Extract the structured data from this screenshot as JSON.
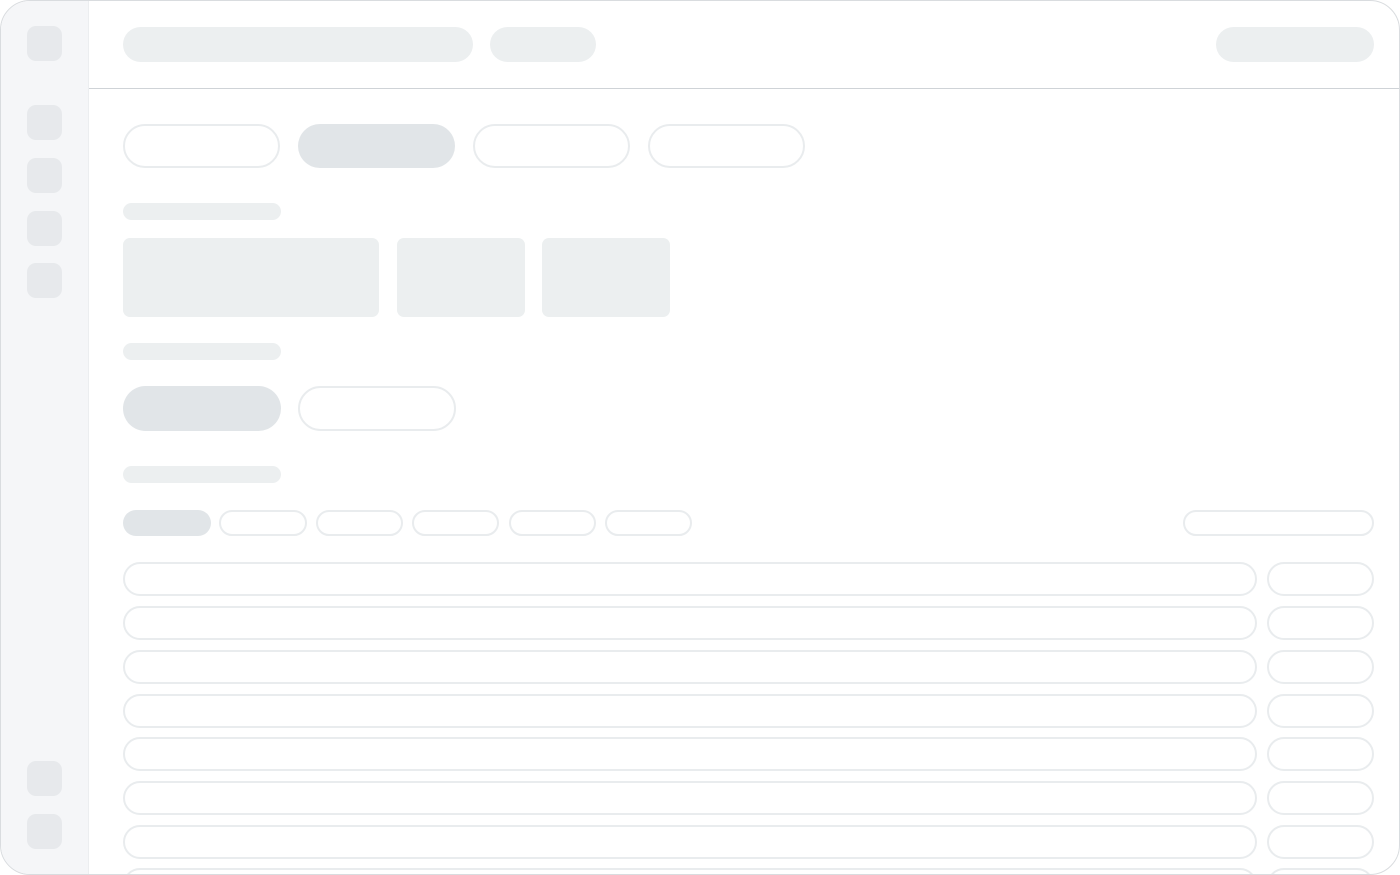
{
  "app": {
    "title": "",
    "breadcrumb": "",
    "header_action": ""
  },
  "sidebar": {
    "top_items": [
      "",
      "",
      "",
      "",
      ""
    ],
    "bottom_items": [
      "",
      ""
    ]
  },
  "tabs": [
    "",
    "",
    "",
    ""
  ],
  "active_tab_index": 1,
  "section_labels": [
    "",
    "",
    ""
  ],
  "summary_cards": [
    "",
    "",
    ""
  ],
  "toggle_buttons": [
    "",
    ""
  ],
  "filter_chips": [
    "",
    "",
    "",
    "",
    "",
    ""
  ],
  "search": {
    "placeholder": "",
    "value": ""
  },
  "table": {
    "rows": [
      {
        "label": "",
        "action": ""
      },
      {
        "label": "",
        "action": ""
      },
      {
        "label": "",
        "action": ""
      },
      {
        "label": "",
        "action": ""
      },
      {
        "label": "",
        "action": ""
      },
      {
        "label": "",
        "action": ""
      },
      {
        "label": "",
        "action": ""
      },
      {
        "label": "",
        "action": ""
      }
    ]
  },
  "colors": {
    "sidebar_bg": "#f5f6f8",
    "placeholder_light": "#eceff0",
    "placeholder_selected": "#e1e5e8",
    "outline": "#e9ecee",
    "divider": "#cfd3d7"
  }
}
